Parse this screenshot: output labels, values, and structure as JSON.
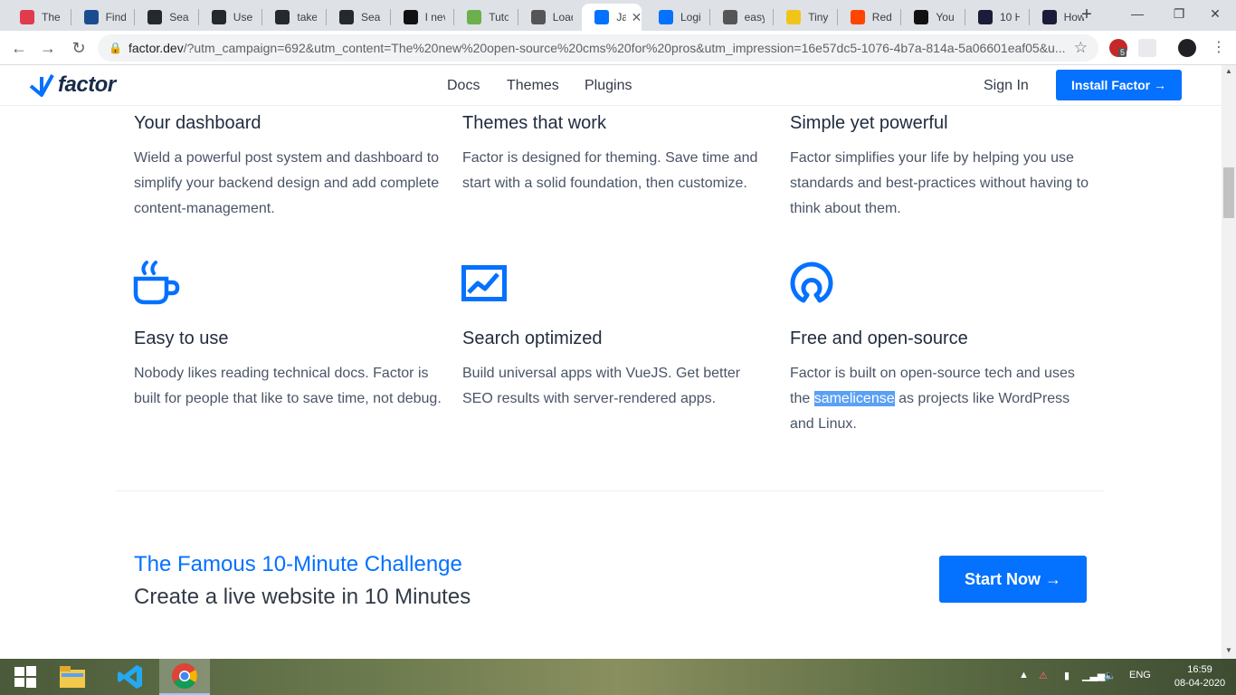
{
  "browser": {
    "tabs": [
      {
        "title": "The f",
        "color": "#e23b4b",
        "icon": "tnw-icon"
      },
      {
        "title": "Find",
        "color": "#1a4d8f",
        "icon": "gov-icon"
      },
      {
        "title": "Searc",
        "color": "#24292e",
        "icon": "github-icon"
      },
      {
        "title": "Use",
        "color": "#24292e",
        "icon": "github-icon"
      },
      {
        "title": "taken",
        "color": "#24292e",
        "icon": "github-icon"
      },
      {
        "title": "Searc",
        "color": "#24292e",
        "icon": "github-icon"
      },
      {
        "title": "I neve",
        "color": "#111111",
        "icon": "medium-icon"
      },
      {
        "title": "Tutor",
        "color": "#6ab04c",
        "icon": "tutorial-icon"
      },
      {
        "title": "Load",
        "color": "#555555",
        "icon": "cube-icon"
      },
      {
        "title": "Ja",
        "color": "#0471ff",
        "icon": "factor-icon",
        "active": true
      },
      {
        "title": "Login",
        "color": "#0471ff",
        "icon": "factor-icon"
      },
      {
        "title": "easy-",
        "color": "#555555",
        "icon": "cube-icon"
      },
      {
        "title": "Tiny",
        "color": "#f0c419",
        "icon": "tiny-icon"
      },
      {
        "title": "Redu",
        "color": "#ff4500",
        "icon": "reddit-icon"
      },
      {
        "title": "You a",
        "color": "#111111",
        "icon": "dev-icon"
      },
      {
        "title": "10 H",
        "color": "#1b1b3a",
        "icon": "lambda-icon"
      },
      {
        "title": "How",
        "color": "#1b1b3a",
        "icon": "lambda-icon"
      }
    ],
    "url_host": "factor.dev",
    "url_rest": "/?utm_campaign=692&utm_content=The%20new%20open-source%20cms%20for%20pros&utm_impression=16e57dc5-1076-4b7a-814a-5a06601eaf05&u...",
    "extension_badge": "5"
  },
  "site": {
    "logo_text": "factor",
    "nav": [
      "Docs",
      "Themes",
      "Plugins"
    ],
    "sign_in": "Sign In",
    "install_button": "Install Factor →",
    "accent": "#0471ff"
  },
  "features": [
    {
      "title": "Your dashboard",
      "text": "Wield a powerful post system and dashboard to simplify your backend design and add complete content-management."
    },
    {
      "title": "Themes that work",
      "text": "Factor is designed for theming. Save time and start with a solid foundation, then customize."
    },
    {
      "title": "Simple yet powerful",
      "text": "Factor simplifies your life by helping you use standards and best-practices without having to think about them."
    },
    {
      "title": "Easy to use",
      "text": "Nobody likes reading technical docs. Factor is built for people that like to save time, not debug.",
      "icon": "coffee-cup-icon"
    },
    {
      "title": "Search optimized",
      "text": "Build universal apps with VueJS. Get better SEO results with server-rendered apps.",
      "icon": "chart-icon"
    },
    {
      "title": "Free and open-source",
      "text_before": "Factor is built on open-source tech and uses the ",
      "text_highlight": "samelicense",
      "text_after": " as projects like WordPress and Linux.",
      "icon": "open-source-icon"
    }
  ],
  "cta": {
    "title": "The Famous 10-Minute Challenge",
    "subtitle": "Create a live website in 10 Minutes",
    "button": "Start Now →"
  },
  "taskbar": {
    "language": "ENG",
    "time": "16:59",
    "date": "08-04-2020"
  }
}
